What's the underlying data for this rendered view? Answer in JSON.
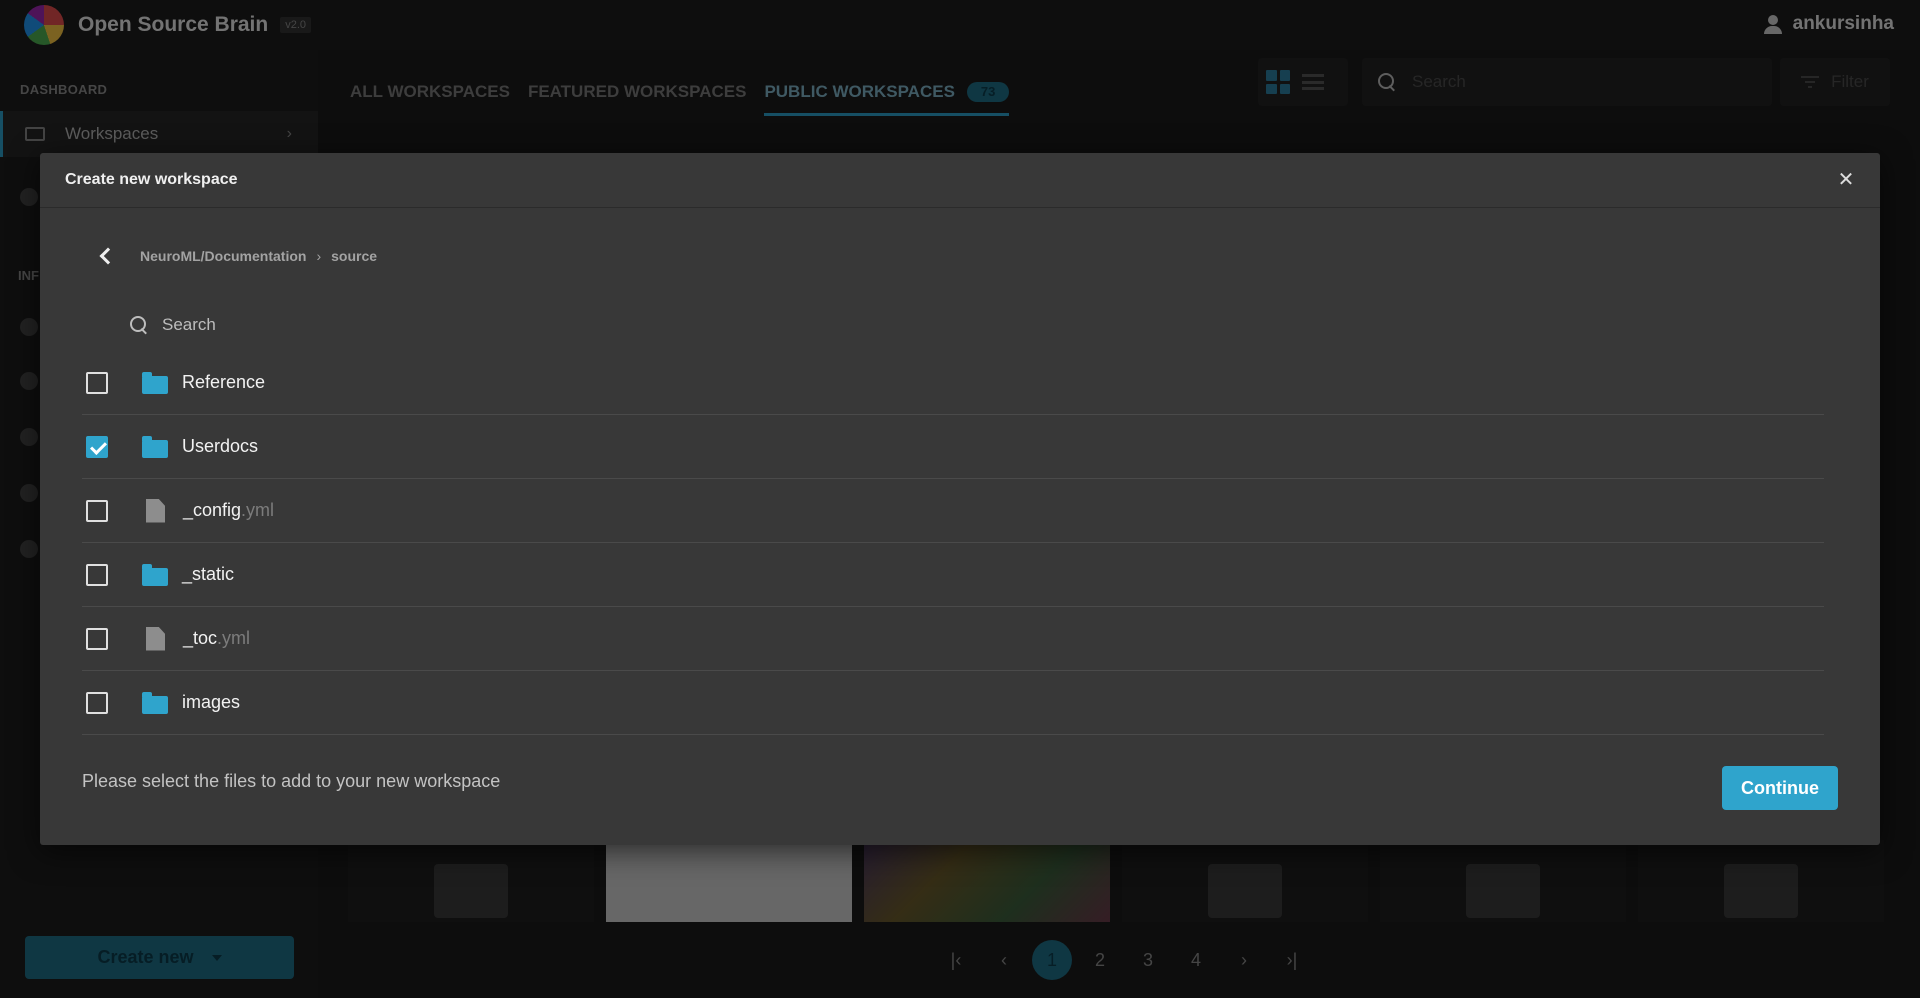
{
  "header": {
    "brand": "Open Source Brain",
    "version": "v2.0",
    "username": "ankursinha"
  },
  "sidebar": {
    "section_dashboard": "DASHBOARD",
    "workspaces_label": "Workspaces",
    "section_info": "INF",
    "create_new": "Create new"
  },
  "main": {
    "tabs": [
      {
        "label": "ALL WORKSPACES"
      },
      {
        "label": "FEATURED WORKSPACES"
      },
      {
        "label": "PUBLIC WORKSPACES",
        "badge": "73"
      }
    ],
    "search_placeholder": "Search",
    "filter_label": "Filter",
    "pages": [
      "1",
      "2",
      "3",
      "4"
    ]
  },
  "dialog": {
    "title": "Create new workspace",
    "breadcrumb": [
      "NeuroML/Documentation",
      "source"
    ],
    "breadcrumb_separator": "›",
    "search_placeholder": "Search",
    "items": [
      {
        "name": "Reference",
        "ext": "",
        "type": "folder",
        "checked": false
      },
      {
        "name": "Userdocs",
        "ext": "",
        "type": "folder",
        "checked": true
      },
      {
        "name": "_config",
        "ext": ".yml",
        "type": "file",
        "checked": false
      },
      {
        "name": "_static",
        "ext": "",
        "type": "folder",
        "checked": false
      },
      {
        "name": "_toc",
        "ext": ".yml",
        "type": "file",
        "checked": false
      },
      {
        "name": "images",
        "ext": "",
        "type": "folder",
        "checked": false
      }
    ],
    "hint": "Please select the files to add to your new workspace",
    "continue_label": "Continue"
  },
  "colors": {
    "accent": "#2fa4cc",
    "dialog_bg": "#383838",
    "page_bg": "#1a1a1a"
  }
}
